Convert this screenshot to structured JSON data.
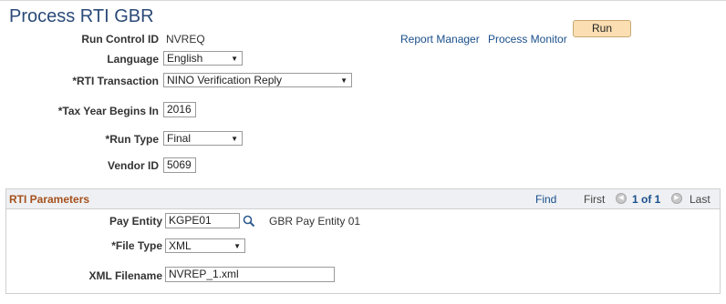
{
  "page": {
    "title": "Process RTI GBR"
  },
  "header_links": {
    "report_manager": "Report Manager",
    "process_monitor": "Process Monitor"
  },
  "run_button": {
    "label": "Run"
  },
  "form": {
    "run_control_id": {
      "label": "Run Control ID",
      "value": "NVREQ"
    },
    "language": {
      "label": "Language",
      "value": "English"
    },
    "rti_transaction": {
      "label": "*RTI Transaction",
      "value": "NINO Verification Reply"
    },
    "tax_year": {
      "label": "*Tax Year Begins In",
      "value": "2016"
    },
    "run_type": {
      "label": "*Run Type",
      "value": "Final"
    },
    "vendor_id": {
      "label": "Vendor ID",
      "value": "5069"
    }
  },
  "rti_parameters": {
    "title": "RTI Parameters",
    "nav": {
      "find": "Find",
      "first": "First",
      "range": "1 of 1",
      "last": "Last"
    },
    "pay_entity": {
      "label": "Pay Entity",
      "value": "KGPE01",
      "description": "GBR Pay Entity 01"
    },
    "file_type": {
      "label": "*File Type",
      "value": "XML"
    },
    "xml_filename": {
      "label": "XML Filename",
      "value": "NVREP_1.xml"
    }
  },
  "colors": {
    "title": "#2b4a78",
    "link": "#1a4f8b",
    "group_title": "#a5511d",
    "run_button": "#fbdfb2"
  },
  "icons": {
    "lookup": "magnifier-icon",
    "prev": "chevron-left-icon",
    "next": "chevron-right-icon",
    "dropdown": "caret-down-icon"
  }
}
